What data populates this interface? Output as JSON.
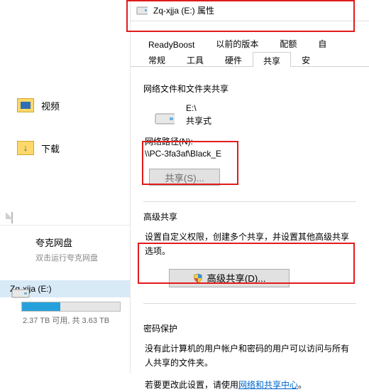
{
  "sidebar": {
    "videos_label": "视频",
    "downloads_label": "下载",
    "quark_title": "夸克网盘",
    "quark_sub": "双击运行夸克网盘",
    "drive_label": "Zq-xjja (E:)",
    "drive_stats": "2.37 TB 可用, 共 3.63 TB"
  },
  "dialog": {
    "title": "Zq-xjja (E:) 属性",
    "tabs_row1": {
      "readyboost": "ReadyBoost",
      "previous": "以前的版本",
      "quota": "配额",
      "custom": "自"
    },
    "tabs_row2": {
      "general": "常规",
      "tools": "工具",
      "hardware": "硬件",
      "sharing": "共享",
      "security": "安"
    },
    "section_netshare": "网络文件和文件夹共享",
    "drive_letter": "E:\\",
    "share_state": "共享式",
    "netpath_label": "网络路径(N):",
    "netpath_value": "\\\\PC-3fa3af\\Black_E",
    "share_btn": "共享(S)...",
    "section_adv": "高级共享",
    "adv_desc": "设置自定义权限，创建多个共享，并设置其他高级共享选项。",
    "adv_btn": "高级共享(D)...",
    "section_pwd": "密码保护",
    "pwd_desc1": "没有此计算机的用户帐户和密码的用户可以访问与所有人共享的文件夹。",
    "pwd_desc2_a": "若要更改此设置，请使用",
    "pwd_link": "网络和共享中心",
    "pwd_desc2_b": "。"
  }
}
